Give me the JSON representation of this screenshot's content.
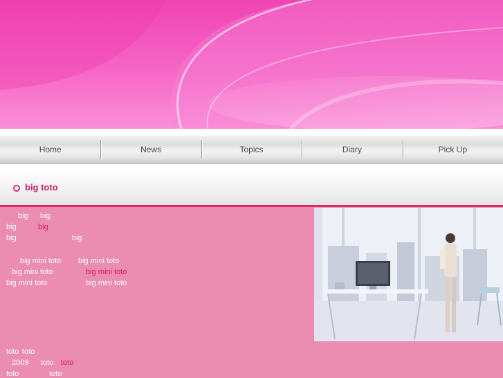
{
  "nav": {
    "items": [
      "Home",
      "News",
      "Topics",
      "Diary",
      "Pick Up"
    ]
  },
  "section": {
    "title": "big  toto"
  },
  "content": {
    "r1a": "big",
    "r1b": "big",
    "r2a": "big",
    "r2b": "big",
    "r3a": "big",
    "r3b": "big",
    "r4a": "big mini toto",
    "r4b": "big mini toto",
    "r5a": "big mini toto",
    "r5b": "big mini toto",
    "r6a": "big mini toto",
    "r6b": "big mini toto",
    "r7a": "toto",
    "r7b": "toto",
    "r8a": "2009",
    "r8b": "toto",
    "r8c": "toto",
    "r9a": "toto",
    "r9b": "toto"
  },
  "colors": {
    "accent": "#d92a6b",
    "highlight_text": "#d8175e",
    "content_bg": "#ea8db1",
    "banner_pink": "#f043b3"
  }
}
